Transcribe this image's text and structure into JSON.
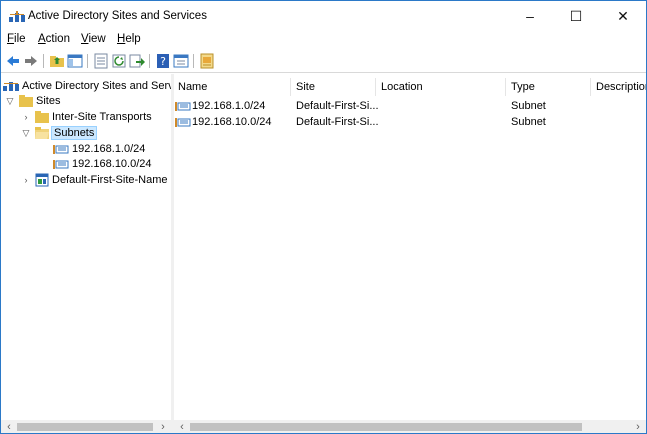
{
  "window": {
    "title": "Active Directory Sites and Services",
    "controls": {
      "minimize": "–",
      "maximize": "☐",
      "close": "✕"
    }
  },
  "menu": [
    {
      "label": "File",
      "access": "F",
      "rest": "ile"
    },
    {
      "label": "Action",
      "access": "A",
      "rest": "ction"
    },
    {
      "label": "View",
      "access": "V",
      "rest": "iew"
    },
    {
      "label": "Help",
      "access": "H",
      "rest": "elp"
    }
  ],
  "toolbar": {
    "icons": [
      "back-icon",
      "forward-icon",
      "up-folder-icon",
      "show-hide-tree-icon",
      "properties-icon",
      "refresh-icon",
      "export-list-icon",
      "help-icon",
      "console-view-icon",
      "new-site-icon"
    ]
  },
  "tree": {
    "root": "Active Directory Sites and Servic",
    "sites": "Sites",
    "inter_site": "Inter-Site Transports",
    "subnets": "Subnets",
    "subnet_1": "192.168.1.0/24",
    "subnet_2": "192.168.10.0/24",
    "default_site": "Default-First-Site-Name"
  },
  "list": {
    "columns": [
      "Name",
      "Site",
      "Location",
      "Type",
      "Description"
    ],
    "rows": [
      {
        "name": "192.168.1.0/24",
        "site": "Default-First-Si...",
        "location": "",
        "type": "Subnet",
        "description": ""
      },
      {
        "name": "192.168.10.0/24",
        "site": "Default-First-Si...",
        "location": "",
        "type": "Subnet",
        "description": ""
      }
    ]
  },
  "scroll": {
    "left_arrow": "‹",
    "right_arrow": "›"
  },
  "colors": {
    "selection": "#cce8ff",
    "folder": "#e8c24c",
    "accent": "#2b79c8"
  }
}
